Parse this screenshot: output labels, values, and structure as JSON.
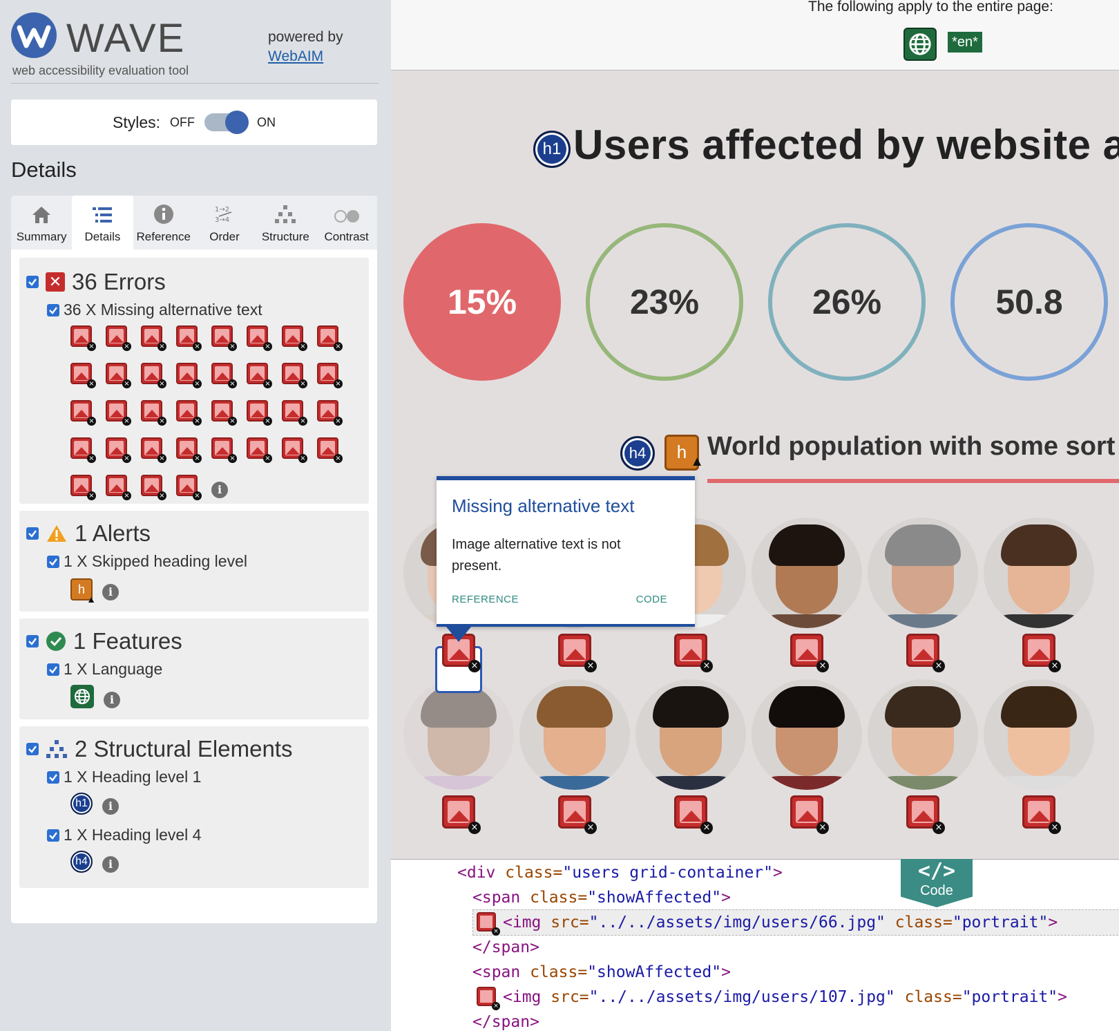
{
  "app": {
    "logo_text": "WAVE",
    "logo_subtitle": "web accessibility evaluation tool",
    "powered_by": "powered by",
    "powered_link": "WebAIM"
  },
  "styles_toggle": {
    "label": "Styles:",
    "off": "OFF",
    "on": "ON",
    "state": "on"
  },
  "details_title": "Details",
  "tabs": [
    {
      "label": "Summary",
      "icon": "home-icon"
    },
    {
      "label": "Details",
      "icon": "list-icon",
      "active": true
    },
    {
      "label": "Reference",
      "icon": "info-icon"
    },
    {
      "label": "Order",
      "icon": "order-icon"
    },
    {
      "label": "Structure",
      "icon": "structure-icon"
    },
    {
      "label": "Contrast",
      "icon": "contrast-icon"
    }
  ],
  "sections": {
    "errors": {
      "count_label": "36 Errors",
      "item_label": "36 X Missing alternative text",
      "icon_count": 36
    },
    "alerts": {
      "count_label": "1 Alerts",
      "item_label": "1 X Skipped heading level"
    },
    "features": {
      "count_label": "1 Features",
      "item_label": "1 X Language"
    },
    "structure": {
      "count_label": "2 Structural Elements",
      "item1_label": "1 X Heading level 1",
      "item2_label": "1 X Heading level 4",
      "h1_badge": "h1",
      "h4_badge": "h4"
    }
  },
  "topbar": {
    "applies_text": "The following apply to the entire page:",
    "lang_badge": "*en*"
  },
  "page": {
    "h1_badge": "h1",
    "h1_text": "Users affected by website a",
    "stats": [
      "15%",
      "23%",
      "26%",
      "50.8"
    ],
    "h4_badge": "h4",
    "h4_alert_badge": "h",
    "h4_text": "World population with some sort o"
  },
  "tooltip": {
    "title": "Missing alternative text",
    "body": "Image alternative text is not present.",
    "reference": "REFERENCE",
    "code": "CODE"
  },
  "code": {
    "toggle_symbol": "</>",
    "toggle_label": "Code",
    "lines": {
      "l1_tag_open": "<div ",
      "l1_attr": "class=",
      "l1_val": "\"users grid-container\"",
      "l1_tag_close": ">",
      "l2_tag_open": "<span ",
      "l2_attr": "class=",
      "l2_val": "\"showAffected\"",
      "l2_tag_close": ">",
      "l3_tag_open": "<img ",
      "l3_attr1": "src=",
      "l3_val1": "\"../../assets/img/users/66.jpg\"",
      "l3_attr2": " class=",
      "l3_val2": "\"portrait\"",
      "l3_tag_close": ">",
      "l4": "</span>",
      "l5_tag_open": "<span ",
      "l5_attr": "class=",
      "l5_val": "\"showAffected\"",
      "l5_tag_close": ">",
      "l6_tag_open": "<img ",
      "l6_attr1": "src=",
      "l6_val1": "\"../../assets/img/users/107.jpg\"",
      "l6_attr2": " class=",
      "l6_val2": "\"portrait\"",
      "l6_tag_close": ">",
      "l7": "</span>"
    }
  }
}
